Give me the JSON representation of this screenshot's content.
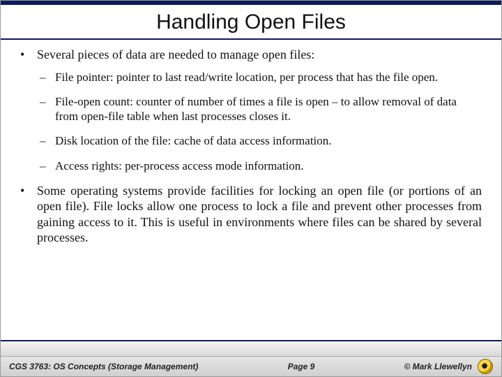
{
  "title": "Handling Open Files",
  "bullets": {
    "b1": "Several pieces of data are needed to manage open files:",
    "b2": "Some operating systems provide facilities for locking an open file (or portions of an open file).  File locks allow one process to lock a file and prevent other processes from gaining access to it.  This is useful in environments where files can be shared by several processes."
  },
  "subs": {
    "s1a": "File pointer:",
    "s1b": "  pointer to last read/write location, per process that has the file open.",
    "s2a": "File-open count:",
    "s2b": " counter of number of times a file is open – to allow removal of data from open-file table when last processes closes it.",
    "s3a": "Disk location of the file:",
    "s3b": " cache of data access information.",
    "s4a": "Access rights:",
    "s4b": " per-process access mode information."
  },
  "footer": {
    "course": "CGS 3763: OS Concepts  (Storage Management)",
    "page": "Page 9",
    "copyright": "© Mark Llewellyn"
  },
  "glyphs": {
    "bullet": "•",
    "dash": "–"
  }
}
